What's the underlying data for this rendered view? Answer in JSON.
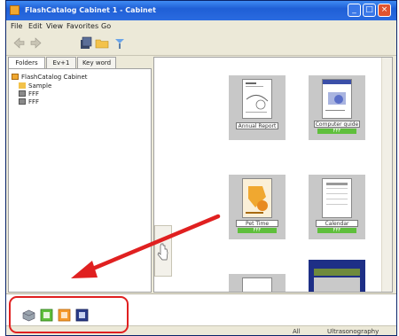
{
  "window": {
    "title": "FlashCatalog Cabinet 1 - Cabinet",
    "controls": {
      "minimize": "_",
      "maximize": "□",
      "close": "×"
    }
  },
  "menu": [
    "File",
    "Edit",
    "View",
    "Favorites",
    "Go"
  ],
  "toolbar": {
    "icons": [
      "back-icon",
      "forward-icon",
      "home-icon",
      "folder-icon",
      "dropper-icon"
    ]
  },
  "left_panel": {
    "tabs": [
      "Folders",
      "Ev+1",
      "Key word"
    ],
    "active_tab": 0,
    "tree": [
      {
        "label": "FlashCatalog Cabinet",
        "icon": "cabinet-icon",
        "level": 0
      },
      {
        "label": "Sample",
        "icon": "folder-icon",
        "level": 1
      },
      {
        "label": "FFF",
        "icon": "stack-icon",
        "level": 1
      },
      {
        "label": "FFF",
        "icon": "stack-icon",
        "level": 1
      }
    ]
  },
  "catalogs": [
    {
      "name": "Annual Report",
      "tag": ""
    },
    {
      "name": "Computer guide",
      "tag": "FFF"
    },
    {
      "name": "Pet Time",
      "tag": "FFF"
    },
    {
      "name": "Calendar",
      "tag": "FFF"
    }
  ],
  "bottom_tray": {
    "icons": [
      "cabinet-icon",
      "catalog-green-icon",
      "catalog-orange-icon",
      "catalog-blue-icon"
    ]
  },
  "status": {
    "left": "All",
    "right": "Ultrasonography"
  },
  "colors": {
    "annotation": "#e02020",
    "title_bar": "#2a6be0",
    "tag_green": "#5fbf3c"
  }
}
